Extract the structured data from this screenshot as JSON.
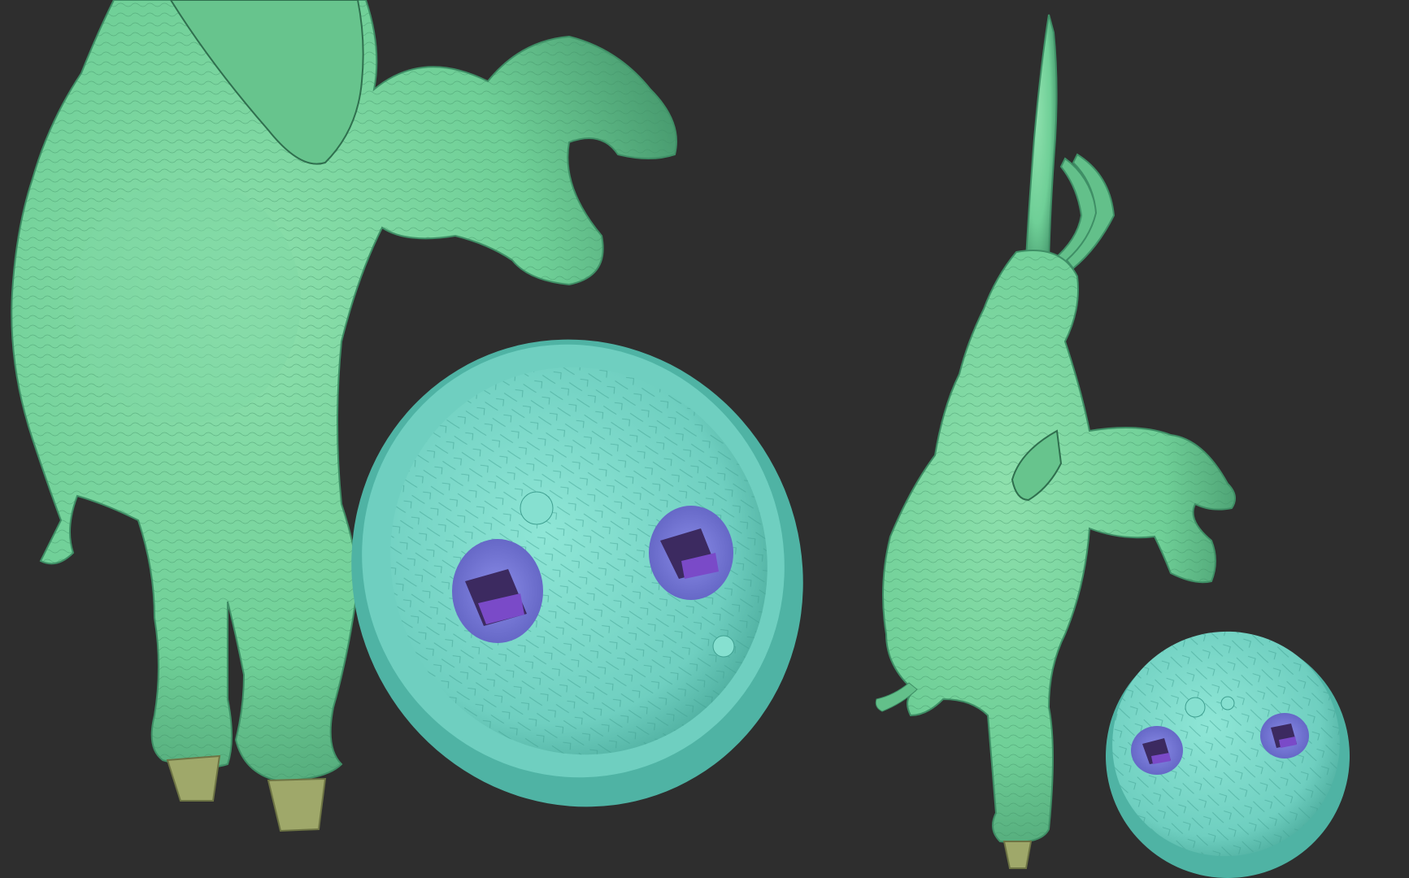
{
  "scene": {
    "background": "#2e2e2e",
    "sculpt_color": "#6fcf97",
    "sculpt_shadow": "#3f8f66",
    "base_color": "#74d6c4",
    "base_shadow": "#3f9f90",
    "socket_color": "#8a8ce8",
    "socket_inner": "#6a3fb0",
    "peg_color": "#9fa86a"
  },
  "views": [
    {
      "name": "closeup-view",
      "subject": "elephant-sculpt",
      "base": "rock-base"
    },
    {
      "name": "full-view",
      "subject": "elephant-sculpt",
      "base": "rock-base"
    }
  ]
}
